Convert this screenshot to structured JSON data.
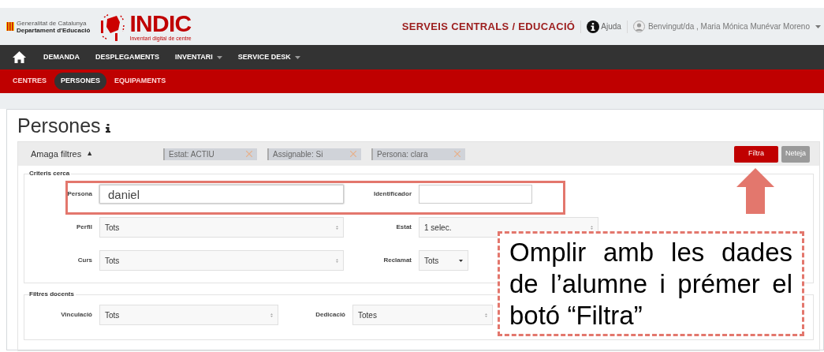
{
  "header": {
    "org_lines": [
      "Generalitat de Catalunya",
      "Departament d'Educació"
    ],
    "app_name": "INDIC",
    "app_subtitle": "Inventari digital de centre",
    "org_title": "SERVEIS CENTRALS / EDUCACIÓ",
    "help": "Ajuda",
    "user": "Benvingut/da , Maria Mónica Munévar Moreno"
  },
  "nav": [
    {
      "label": "DEMANDA",
      "dropdown": false
    },
    {
      "label": "DESPLEGAMENTS",
      "dropdown": false
    },
    {
      "label": "INVENTARI",
      "dropdown": true
    },
    {
      "label": "SERVICE DESK",
      "dropdown": true
    }
  ],
  "subnav": [
    {
      "label": "CENTRES",
      "selected": false
    },
    {
      "label": "PERSONES",
      "selected": true
    },
    {
      "label": "EQUIPAMENTS",
      "selected": false
    }
  ],
  "page_title": "Persones",
  "filters": {
    "toggle": "Amaga filtres",
    "toggle_icon": "▲",
    "tags": [
      {
        "label": "Estat: ACTIU"
      },
      {
        "label": "Assignable: Si"
      },
      {
        "label": "Persona: clara"
      }
    ],
    "buttons": [
      {
        "label": "Filtra",
        "disabled": false
      },
      {
        "label": "Neteja",
        "disabled": true
      }
    ]
  },
  "fieldsets": [
    {
      "legend": "Criteris cerca",
      "rows": [
        [
          {
            "label": "Persona",
            "kind": "input",
            "value": "daniel",
            "focused": true
          },
          {
            "label": "Identificador",
            "kind": "input",
            "focused": false
          }
        ],
        [
          {
            "label": "Perfil",
            "kind": "select",
            "value": "Tots"
          },
          {
            "label": "Estat",
            "kind": "select",
            "value": "1 selec."
          }
        ],
        [
          {
            "label": "Curs",
            "kind": "select",
            "value": "Tots"
          },
          {
            "label": "Reclamat",
            "kind": "dropdown",
            "value": "Tots"
          }
        ]
      ]
    },
    {
      "legend": "Filtres docents",
      "rows": [
        [
          {
            "label": "Vinculació",
            "kind": "select",
            "value": "Tots"
          },
          {
            "label": "Dedicació",
            "kind": "select",
            "value": "Totes"
          }
        ]
      ]
    }
  ],
  "annotation": {
    "text": "Omplir amb les dades de l’alumne i prémer el botó “Filtra”"
  }
}
